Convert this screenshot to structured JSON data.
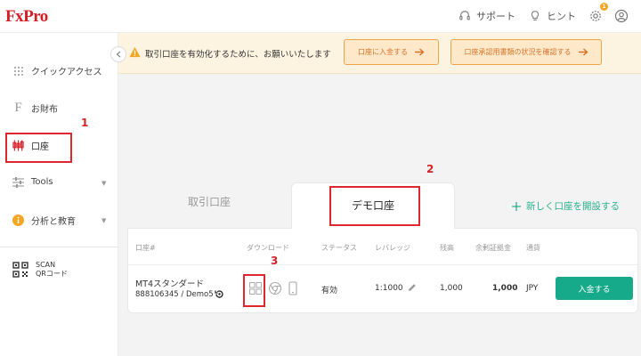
{
  "header": {
    "logo": "FxPro",
    "support": "サポート",
    "hint": "ヒント",
    "badge_count": "1"
  },
  "sidebar": {
    "items": [
      {
        "label": "クイックアクセス",
        "icon": "grid-icon"
      },
      {
        "label": "お財布",
        "icon": "wallet-f-icon"
      },
      {
        "label": "口座",
        "icon": "candlestick-icon"
      },
      {
        "label": "Tools",
        "icon": "sliders-icon"
      },
      {
        "label": "分析と教育",
        "icon": "info-icon"
      }
    ],
    "scan_line1": "SCAN",
    "scan_line2": "QRコード"
  },
  "banner": {
    "message": "取引口座を有効化するために、お願いいたします",
    "button1": "口座に入金する",
    "button2": "口座承認用書類の状況を確認する"
  },
  "tabs": {
    "live": "取引口座",
    "demo": "デモ口座",
    "new_account": "新しく口座を開設する"
  },
  "table": {
    "headers": [
      "口座#",
      "ダウンロード",
      "ステータス",
      "レバレッジ",
      "残高",
      "余剰証拠金",
      "通貨"
    ],
    "row": {
      "name": "MT4スタンダード",
      "number": "888106345 / Demo5",
      "status": "有効",
      "leverage": "1:1000",
      "balance": "1,000",
      "free_margin": "1,000",
      "currency": "JPY",
      "action": "入金する"
    }
  },
  "annotations": [
    "1",
    "2",
    "3"
  ],
  "colors": {
    "brand": "#d51f26",
    "accent": "#16a98a",
    "warning": "#f0a44c"
  }
}
